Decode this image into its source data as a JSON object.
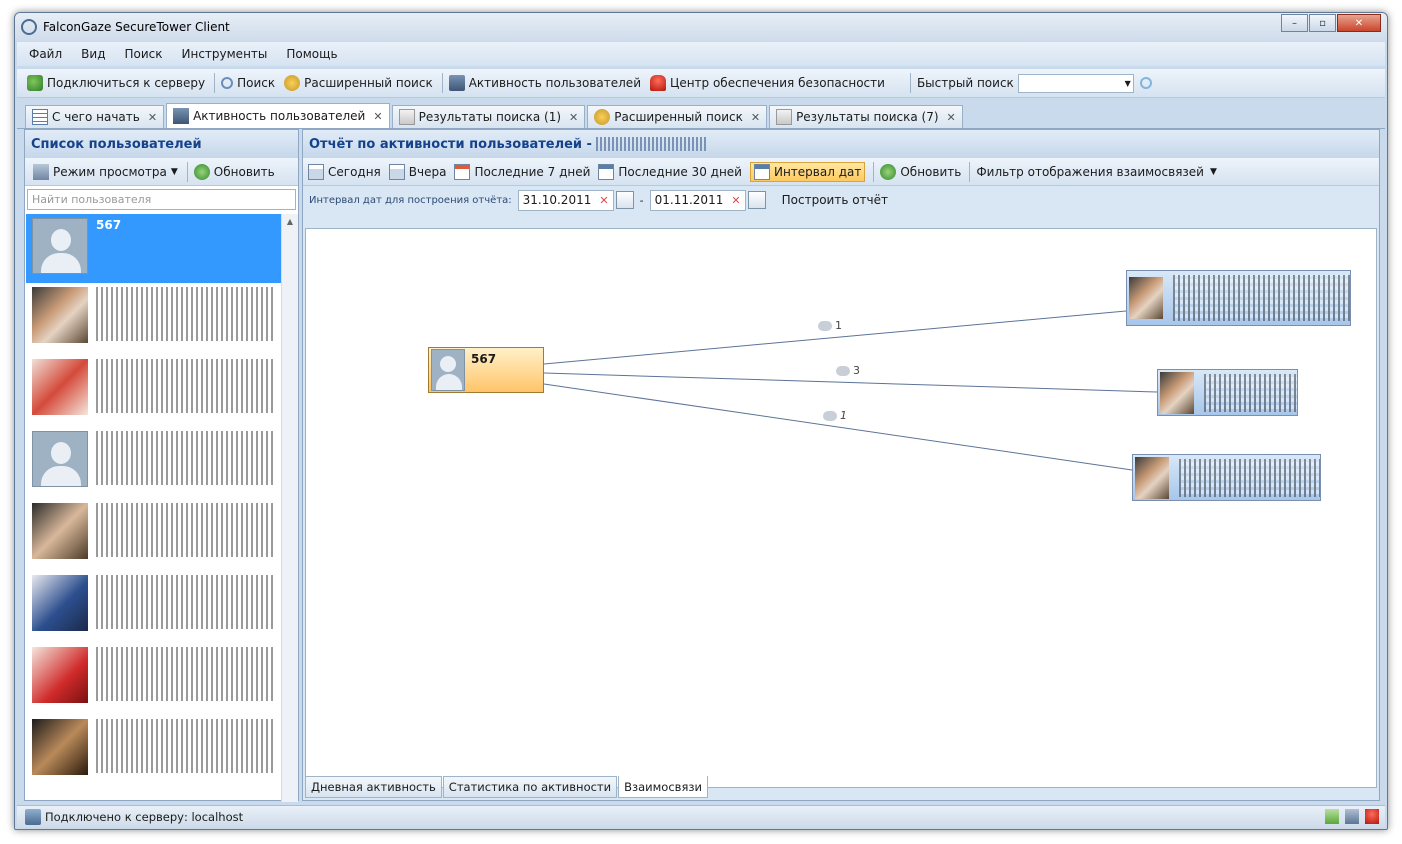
{
  "window": {
    "title": "FalconGaze SecureTower Client",
    "controls": [
      "–",
      "▫",
      "✕"
    ]
  },
  "menu": [
    "Файл",
    "Вид",
    "Поиск",
    "Инструменты",
    "Помощь"
  ],
  "toolbar": {
    "connect": "Подключиться к серверу",
    "search": "Поиск",
    "advanced_search": "Расширенный поиск",
    "user_activity": "Активность пользователей",
    "security_center": "Центр обеспечения безопасности",
    "quick_search_label": "Быстрый поиск",
    "quick_search_value": ""
  },
  "tabs": [
    {
      "label": "С чего начать",
      "active": false
    },
    {
      "label": "Активность пользователей",
      "active": true
    },
    {
      "label": "Результаты поиска (1)",
      "active": false
    },
    {
      "label": "Расширенный поиск",
      "active": false
    },
    {
      "label": "Результаты поиска (7)",
      "active": false
    }
  ],
  "left_panel": {
    "title": "Список пользователей",
    "view_mode": "Режим просмотра",
    "refresh": "Обновить",
    "search_placeholder": "Найти пользователя",
    "selected_user": "567"
  },
  "right_panel": {
    "title": "Отчёт по активности пользователей -",
    "buttons": {
      "today": "Сегодня",
      "yesterday": "Вчера",
      "last7": "Последние 7 дней",
      "last30": "Последние 30 дней",
      "interval": "Интервал дат",
      "refresh": "Обновить",
      "filter": "Фильтр отображения взаимосвязей"
    },
    "date_label": "Интервал дат для построения отчёта:",
    "date_from": "31.10.2011",
    "date_dash": "-",
    "date_to": "01.11.2011",
    "build": "Построить отчёт"
  },
  "graph": {
    "center_label": "567",
    "edges": [
      {
        "count": "1"
      },
      {
        "count": "3"
      },
      {
        "count": "1"
      }
    ]
  },
  "bottom_tabs": [
    {
      "label": "Дневная активность",
      "active": false
    },
    {
      "label": "Статистика по активности",
      "active": false
    },
    {
      "label": "Взаимосвязи",
      "active": true
    }
  ],
  "status": {
    "text": "Подключено к серверу: localhost"
  }
}
